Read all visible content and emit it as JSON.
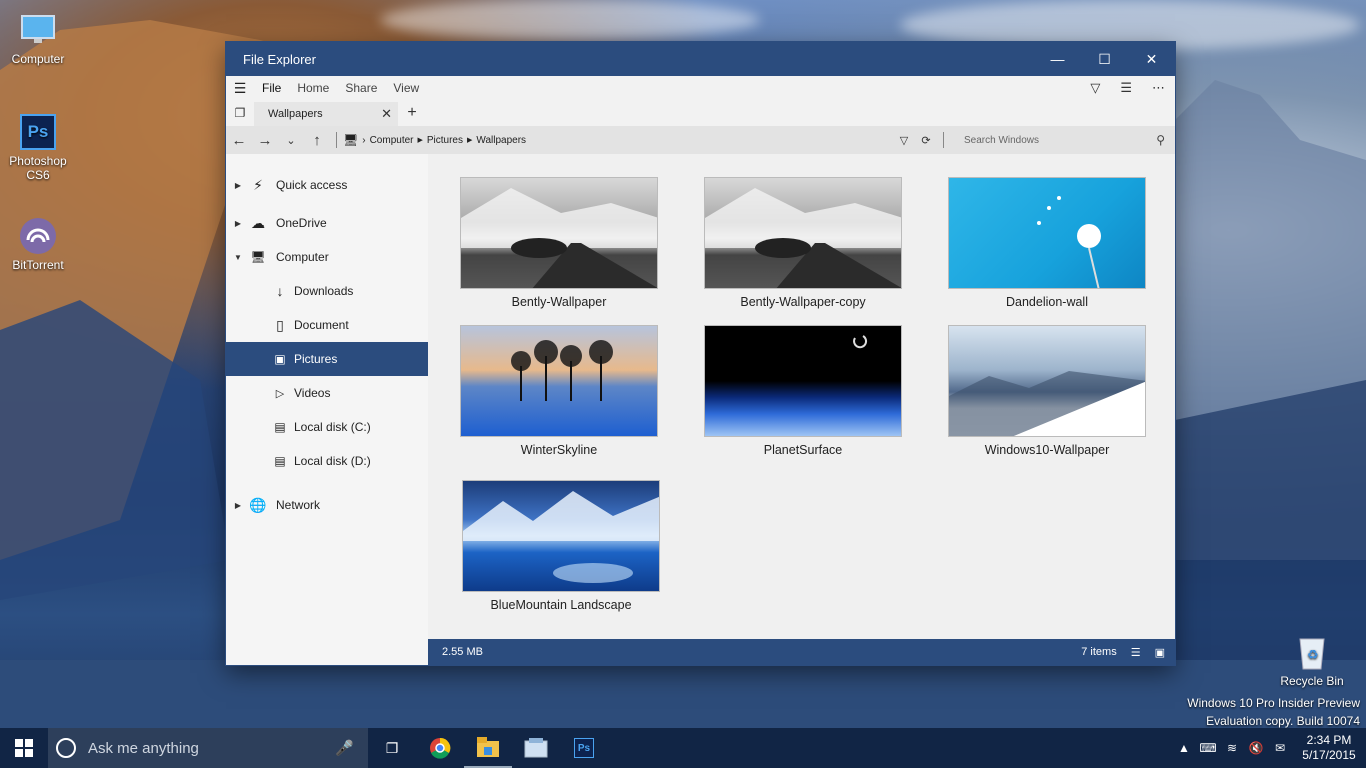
{
  "desktop": {
    "icons": [
      {
        "label": "Computer"
      },
      {
        "label": "Photoshop CS6",
        "glyph": "Ps"
      },
      {
        "label": "BitTorrent"
      },
      {
        "label": "Recycle Bin"
      }
    ],
    "watermark_line1": "Windows 10 Pro Insider Preview",
    "watermark_line2": "Evaluation copy. Build 10074"
  },
  "window": {
    "title": "File Explorer",
    "menu": {
      "file": "File",
      "home": "Home",
      "share": "Share",
      "view": "View"
    },
    "tab_label": "Wallpapers",
    "breadcrumb": [
      "Computer",
      "Pictures",
      "Wallpapers"
    ],
    "search_placeholder": "Search Windows",
    "sidebar": {
      "quick_access": "Quick access",
      "onedrive": "OneDrive",
      "computer": "Computer",
      "downloads": "Downloads",
      "document": "Document",
      "pictures": "Pictures",
      "videos": "Videos",
      "local_c": "Local disk (C:)",
      "local_d": "Local disk (D:)",
      "network": "Network"
    },
    "files": [
      {
        "name": "Bently-Wallpaper"
      },
      {
        "name": "Bently-Wallpaper-copy"
      },
      {
        "name": "Dandelion-wall"
      },
      {
        "name": "WinterSkyline"
      },
      {
        "name": "PlanetSurface"
      },
      {
        "name": "Windows10-Wallpaper"
      },
      {
        "name": "BlueMountain Landscape"
      }
    ],
    "status": {
      "size": "2.55 MB",
      "count": "7 items"
    }
  },
  "taskbar": {
    "search_placeholder": "Ask me anything",
    "time": "2:34 PM",
    "date": "5/17/2015",
    "ps_glyph": "Ps"
  }
}
